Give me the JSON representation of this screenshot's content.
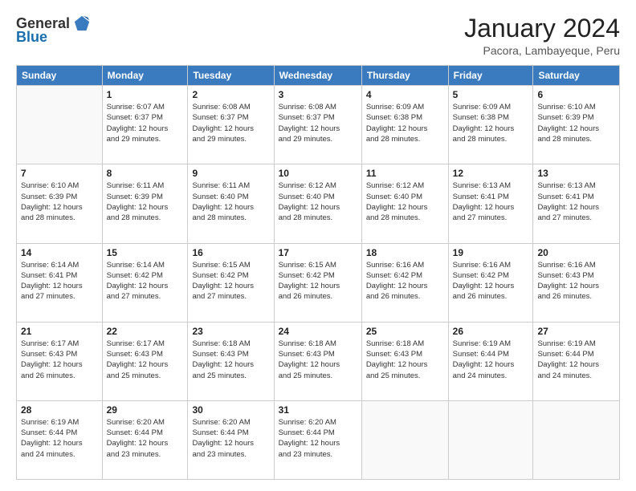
{
  "header": {
    "logo_general": "General",
    "logo_blue": "Blue",
    "month_title": "January 2024",
    "location": "Pacora, Lambayeque, Peru"
  },
  "weekdays": [
    "Sunday",
    "Monday",
    "Tuesday",
    "Wednesday",
    "Thursday",
    "Friday",
    "Saturday"
  ],
  "weeks": [
    [
      {
        "day": "",
        "info": ""
      },
      {
        "day": "1",
        "info": "Sunrise: 6:07 AM\nSunset: 6:37 PM\nDaylight: 12 hours\nand 29 minutes."
      },
      {
        "day": "2",
        "info": "Sunrise: 6:08 AM\nSunset: 6:37 PM\nDaylight: 12 hours\nand 29 minutes."
      },
      {
        "day": "3",
        "info": "Sunrise: 6:08 AM\nSunset: 6:37 PM\nDaylight: 12 hours\nand 29 minutes."
      },
      {
        "day": "4",
        "info": "Sunrise: 6:09 AM\nSunset: 6:38 PM\nDaylight: 12 hours\nand 28 minutes."
      },
      {
        "day": "5",
        "info": "Sunrise: 6:09 AM\nSunset: 6:38 PM\nDaylight: 12 hours\nand 28 minutes."
      },
      {
        "day": "6",
        "info": "Sunrise: 6:10 AM\nSunset: 6:39 PM\nDaylight: 12 hours\nand 28 minutes."
      }
    ],
    [
      {
        "day": "7",
        "info": "Sunrise: 6:10 AM\nSunset: 6:39 PM\nDaylight: 12 hours\nand 28 minutes."
      },
      {
        "day": "8",
        "info": "Sunrise: 6:11 AM\nSunset: 6:39 PM\nDaylight: 12 hours\nand 28 minutes."
      },
      {
        "day": "9",
        "info": "Sunrise: 6:11 AM\nSunset: 6:40 PM\nDaylight: 12 hours\nand 28 minutes."
      },
      {
        "day": "10",
        "info": "Sunrise: 6:12 AM\nSunset: 6:40 PM\nDaylight: 12 hours\nand 28 minutes."
      },
      {
        "day": "11",
        "info": "Sunrise: 6:12 AM\nSunset: 6:40 PM\nDaylight: 12 hours\nand 28 minutes."
      },
      {
        "day": "12",
        "info": "Sunrise: 6:13 AM\nSunset: 6:41 PM\nDaylight: 12 hours\nand 27 minutes."
      },
      {
        "day": "13",
        "info": "Sunrise: 6:13 AM\nSunset: 6:41 PM\nDaylight: 12 hours\nand 27 minutes."
      }
    ],
    [
      {
        "day": "14",
        "info": "Sunrise: 6:14 AM\nSunset: 6:41 PM\nDaylight: 12 hours\nand 27 minutes."
      },
      {
        "day": "15",
        "info": "Sunrise: 6:14 AM\nSunset: 6:42 PM\nDaylight: 12 hours\nand 27 minutes."
      },
      {
        "day": "16",
        "info": "Sunrise: 6:15 AM\nSunset: 6:42 PM\nDaylight: 12 hours\nand 27 minutes."
      },
      {
        "day": "17",
        "info": "Sunrise: 6:15 AM\nSunset: 6:42 PM\nDaylight: 12 hours\nand 26 minutes."
      },
      {
        "day": "18",
        "info": "Sunrise: 6:16 AM\nSunset: 6:42 PM\nDaylight: 12 hours\nand 26 minutes."
      },
      {
        "day": "19",
        "info": "Sunrise: 6:16 AM\nSunset: 6:42 PM\nDaylight: 12 hours\nand 26 minutes."
      },
      {
        "day": "20",
        "info": "Sunrise: 6:16 AM\nSunset: 6:43 PM\nDaylight: 12 hours\nand 26 minutes."
      }
    ],
    [
      {
        "day": "21",
        "info": "Sunrise: 6:17 AM\nSunset: 6:43 PM\nDaylight: 12 hours\nand 26 minutes."
      },
      {
        "day": "22",
        "info": "Sunrise: 6:17 AM\nSunset: 6:43 PM\nDaylight: 12 hours\nand 25 minutes."
      },
      {
        "day": "23",
        "info": "Sunrise: 6:18 AM\nSunset: 6:43 PM\nDaylight: 12 hours\nand 25 minutes."
      },
      {
        "day": "24",
        "info": "Sunrise: 6:18 AM\nSunset: 6:43 PM\nDaylight: 12 hours\nand 25 minutes."
      },
      {
        "day": "25",
        "info": "Sunrise: 6:18 AM\nSunset: 6:43 PM\nDaylight: 12 hours\nand 25 minutes."
      },
      {
        "day": "26",
        "info": "Sunrise: 6:19 AM\nSunset: 6:44 PM\nDaylight: 12 hours\nand 24 minutes."
      },
      {
        "day": "27",
        "info": "Sunrise: 6:19 AM\nSunset: 6:44 PM\nDaylight: 12 hours\nand 24 minutes."
      }
    ],
    [
      {
        "day": "28",
        "info": "Sunrise: 6:19 AM\nSunset: 6:44 PM\nDaylight: 12 hours\nand 24 minutes."
      },
      {
        "day": "29",
        "info": "Sunrise: 6:20 AM\nSunset: 6:44 PM\nDaylight: 12 hours\nand 23 minutes."
      },
      {
        "day": "30",
        "info": "Sunrise: 6:20 AM\nSunset: 6:44 PM\nDaylight: 12 hours\nand 23 minutes."
      },
      {
        "day": "31",
        "info": "Sunrise: 6:20 AM\nSunset: 6:44 PM\nDaylight: 12 hours\nand 23 minutes."
      },
      {
        "day": "",
        "info": ""
      },
      {
        "day": "",
        "info": ""
      },
      {
        "day": "",
        "info": ""
      }
    ]
  ]
}
